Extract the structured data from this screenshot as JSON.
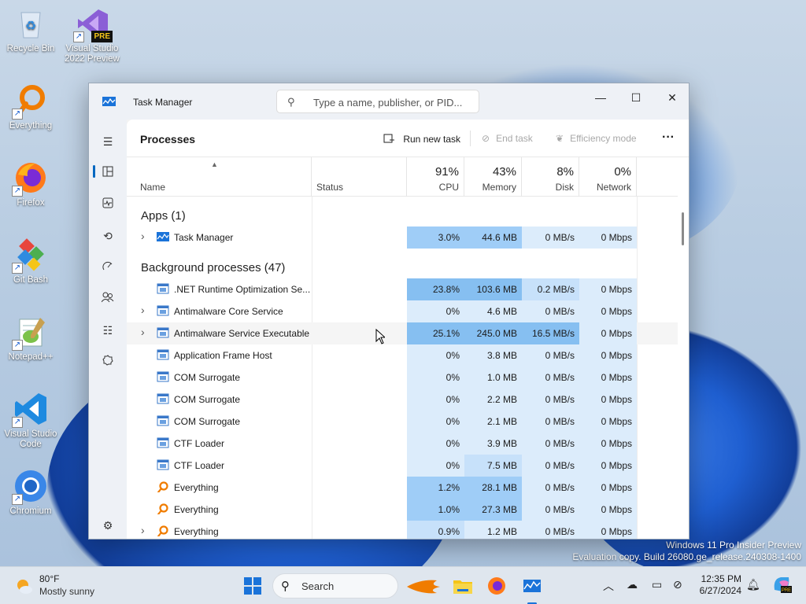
{
  "desktop": {
    "icons": [
      {
        "label": "Recycle Bin"
      },
      {
        "label": "Visual Studio 2022 Preview",
        "badge": "PRE"
      },
      {
        "label": "Everything"
      },
      {
        "label": "Firefox"
      },
      {
        "label": "Git Bash"
      },
      {
        "label": "Notepad++"
      },
      {
        "label": "Visual Studio Code"
      },
      {
        "label": "Chromium"
      }
    ],
    "watermark": {
      "line1": "Windows 11 Pro Insider Preview",
      "line2": "Evaluation copy. Build 26080.ge_release.240308-1400"
    }
  },
  "window": {
    "title": "Task Manager",
    "search_placeholder": "Type a name, publisher, or PID...",
    "controls": {
      "minimize": "—",
      "maximize": "☐",
      "close": "✕"
    }
  },
  "commandbar": {
    "page_title": "Processes",
    "run_new_task": "Run new task",
    "end_task": "End task",
    "efficiency_mode": "Efficiency mode",
    "more": "···"
  },
  "columns": {
    "name": "Name",
    "status": "Status",
    "cpu": {
      "pct": "91%",
      "label": "CPU"
    },
    "memory": {
      "pct": "43%",
      "label": "Memory"
    },
    "disk": {
      "pct": "8%",
      "label": "Disk"
    },
    "network": {
      "pct": "0%",
      "label": "Network"
    }
  },
  "groups": {
    "apps": "Apps (1)",
    "background": "Background processes (47)"
  },
  "rows": [
    {
      "name": "Task Manager",
      "cpu": "3.0%",
      "mem": "44.6 MB",
      "disk": "0 MB/s",
      "net": "0 Mbps",
      "expandable": true,
      "icon": "taskmgr-icon"
    },
    {
      "name": ".NET Runtime Optimization Se...",
      "cpu": "23.8%",
      "mem": "103.6 MB",
      "disk": "0.2 MB/s",
      "net": "0 Mbps",
      "expandable": false,
      "icon": "window-icon"
    },
    {
      "name": "Antimalware Core Service",
      "cpu": "0%",
      "mem": "4.6 MB",
      "disk": "0 MB/s",
      "net": "0 Mbps",
      "expandable": true,
      "icon": "window-icon"
    },
    {
      "name": "Antimalware Service Executable",
      "cpu": "25.1%",
      "mem": "245.0 MB",
      "disk": "16.5 MB/s",
      "net": "0 Mbps",
      "expandable": true,
      "icon": "window-icon"
    },
    {
      "name": "Application Frame Host",
      "cpu": "0%",
      "mem": "3.8 MB",
      "disk": "0 MB/s",
      "net": "0 Mbps",
      "expandable": false,
      "icon": "window-icon"
    },
    {
      "name": "COM Surrogate",
      "cpu": "0%",
      "mem": "1.0 MB",
      "disk": "0 MB/s",
      "net": "0 Mbps",
      "expandable": false,
      "icon": "window-icon"
    },
    {
      "name": "COM Surrogate",
      "cpu": "0%",
      "mem": "2.2 MB",
      "disk": "0 MB/s",
      "net": "0 Mbps",
      "expandable": false,
      "icon": "window-icon"
    },
    {
      "name": "COM Surrogate",
      "cpu": "0%",
      "mem": "2.1 MB",
      "disk": "0 MB/s",
      "net": "0 Mbps",
      "expandable": false,
      "icon": "window-icon"
    },
    {
      "name": "CTF Loader",
      "cpu": "0%",
      "mem": "3.9 MB",
      "disk": "0 MB/s",
      "net": "0 Mbps",
      "expandable": false,
      "icon": "window-icon"
    },
    {
      "name": "CTF Loader",
      "cpu": "0%",
      "mem": "7.5 MB",
      "disk": "0 MB/s",
      "net": "0 Mbps",
      "expandable": false,
      "icon": "window-icon"
    },
    {
      "name": "Everything",
      "cpu": "1.2%",
      "mem": "28.1 MB",
      "disk": "0 MB/s",
      "net": "0 Mbps",
      "expandable": false,
      "icon": "everything-icon"
    },
    {
      "name": "Everything",
      "cpu": "1.0%",
      "mem": "27.3 MB",
      "disk": "0 MB/s",
      "net": "0 Mbps",
      "expandable": false,
      "icon": "everything-icon"
    },
    {
      "name": "Everything",
      "cpu": "0.9%",
      "mem": "1.2 MB",
      "disk": "0 MB/s",
      "net": "0 Mbps",
      "expandable": true,
      "icon": "everything-icon"
    }
  ],
  "taskbar": {
    "weather_temp": "80°F",
    "weather_desc": "Mostly sunny",
    "search_label": "Search",
    "time": "12:35 PM",
    "date": "6/27/2024"
  }
}
